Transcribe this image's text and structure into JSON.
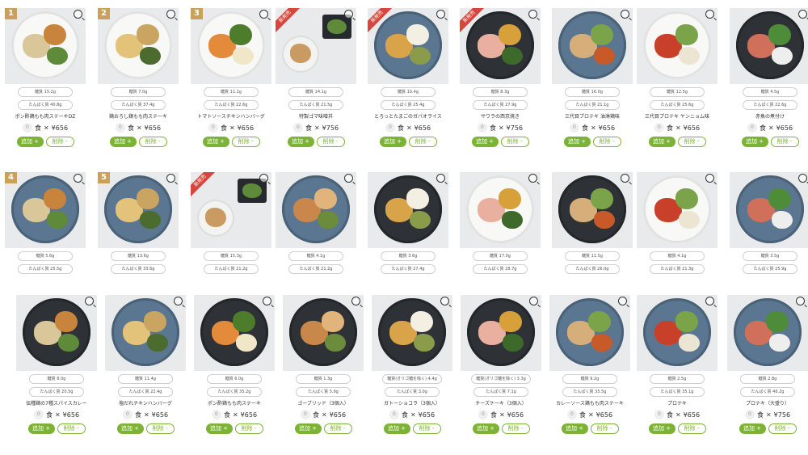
{
  "buttons": {
    "add": "追加 +",
    "remove": "削除 -",
    "times": "×",
    "zero": "0"
  },
  "food_icon_glyph": "食",
  "colors": {
    "accent": "#7cb335",
    "rank": "#c9a15a",
    "new_tag": "#d8453c"
  },
  "items": [
    {
      "carb": "糖質 15.2g",
      "protein": "たんぱく質 40.8g",
      "name": "ポン酢鶏もも肉ステーキDZ",
      "price": "¥656",
      "rank": "1",
      "plate": "white"
    },
    {
      "carb": "糖質 7.0g",
      "protein": "たんぱく質 37.4g",
      "name": "鶏おろし鶏もも肉ステーキ",
      "price": "¥656",
      "rank": "2",
      "plate": "white"
    },
    {
      "carb": "糖質 11.2g",
      "protein": "たんぱく質 22.6g",
      "name": "トマトソースチキンハンバーグ",
      "price": "¥656",
      "rank": "3",
      "plate": "white"
    },
    {
      "carb": "糖質 14.1g",
      "protein": "たんぱく質 21.5g",
      "name": "特製ゴマ味噌丼",
      "price": "¥756",
      "new": "新発売",
      "plate": "bento"
    },
    {
      "carb": "糖質 10.4g",
      "protein": "たんぱく質 25.4g",
      "name": "とろっとたまごのガパオライス",
      "price": "¥656",
      "new": "新発売",
      "plate": "blue"
    },
    {
      "carb": "糖質 8.3g",
      "protein": "たんぱく質 27.9g",
      "name": "サワラの西京焼き",
      "price": "¥756",
      "new": "新発売",
      "plate": "dark"
    },
    {
      "carb": "糖質 16.0g",
      "protein": "たんぱく質 21.1g",
      "name": "三代目プロテキ 油淋鶏味",
      "price": "¥656",
      "plate": "blue"
    },
    {
      "carb": "糖質 12.5g",
      "protein": "たんぱく質 25.6g",
      "name": "三代目プロテキ ヤンニョム味",
      "price": "¥656",
      "plate": "white"
    },
    {
      "carb": "糖質 4.5g",
      "protein": "たんぱく質 22.6g",
      "name": "赤魚の煮付け",
      "price": "¥656",
      "plate": "dark"
    },
    {
      "carb": "糖質 5.6g",
      "protein": "たんぱく質 25.5g",
      "rank": "4",
      "plate": "blue"
    },
    {
      "carb": "糖質 13.6g",
      "protein": "たんぱく質 33.6g",
      "rank": "5",
      "plate": "blue"
    },
    {
      "carb": "糖質 15.3g",
      "protein": "たんぱく質 21.2g",
      "new": "新発売",
      "plate": "bento2"
    },
    {
      "carb": "糖質 4.1g",
      "protein": "たんぱく質 21.2g",
      "plate": "blue"
    },
    {
      "carb": "糖質 3.6g",
      "protein": "たんぱく質 27.4g",
      "plate": "dark"
    },
    {
      "carb": "糖質 17.0g",
      "protein": "たんぱく質 28.7g",
      "plate": "white"
    },
    {
      "carb": "糖質 11.5g",
      "protein": "たんぱく質 26.0g",
      "plate": "dark"
    },
    {
      "carb": "糖質 4.1g",
      "protein": "たんぱく質 21.3g",
      "plate": "white"
    },
    {
      "carb": "糖質 3.5g",
      "protein": "たんぱく質 25.9g",
      "plate": "blue"
    },
    {
      "carb": "糖質 8.0g",
      "protein": "たんぱく質 20.5g",
      "name": "伝種鶏の7種スパイスカレー",
      "price": "¥656",
      "plate": "dark"
    },
    {
      "carb": "糖質 11.4g",
      "protein": "たんぱく質 22.4g",
      "name": "塩だれチキンハンバーグ",
      "price": "¥656",
      "plate": "blue"
    },
    {
      "carb": "糖質 6.0g",
      "protein": "たんぱく質 35.2g",
      "name": "ポン酢鶏もも肉ステーキ",
      "price": "¥656",
      "plate": "dark"
    },
    {
      "carb": "糖質 1.3g",
      "protein": "たんぱく質 5.9g",
      "name": "ゴーブリッド（3個入）",
      "price": "¥656",
      "plate": "dark"
    },
    {
      "carb": "糖質(オリゴ糖を除く) 4.4g",
      "protein": "たんぱく質 3.0g",
      "name": "ガトーショコラ（3個入）",
      "price": "¥656",
      "plate": "dark",
      "wide": true
    },
    {
      "carb": "糖質(オリゴ糖を除く) 3.3g",
      "protein": "たんぱく質 7.1g",
      "name": "チーズケーキ（3個入）",
      "price": "¥656",
      "plate": "dark",
      "wide": true
    },
    {
      "carb": "糖質 9.2g",
      "protein": "たんぱく質 35.5g",
      "name": "カレーソース鶏もも肉ステーキ",
      "price": "¥656",
      "plate": "blue"
    },
    {
      "carb": "糖質 2.5g",
      "protein": "たんぱく質 35.1g",
      "name": "プロテキ",
      "price": "¥656",
      "plate": "blue"
    },
    {
      "carb": "糖質 2.8g",
      "protein": "たんぱく質 46.2g",
      "name": "プロテキ（大盛り）",
      "price": "¥756",
      "plate": "blue"
    }
  ]
}
